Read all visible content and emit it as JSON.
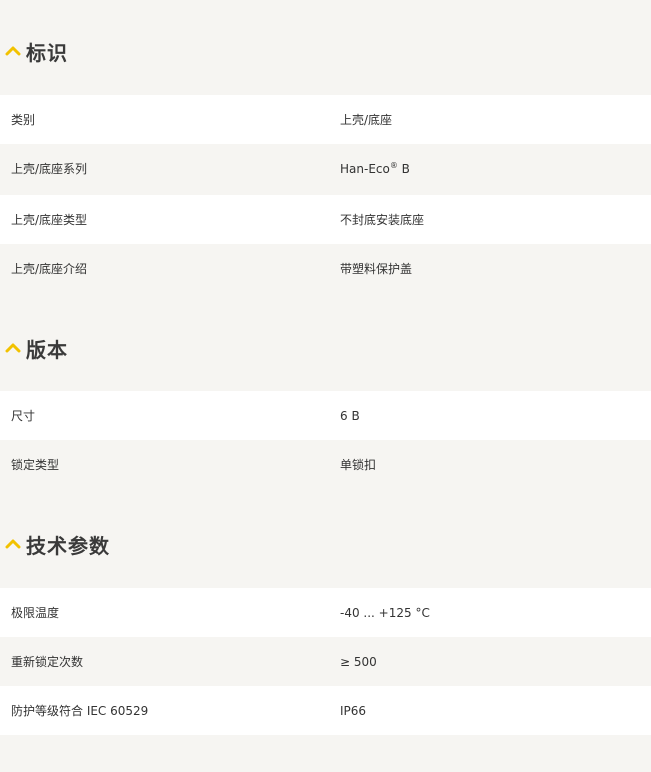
{
  "sections": [
    {
      "title": "标识",
      "rows": [
        {
          "label": "类别",
          "value": "上壳/底座"
        },
        {
          "label": "上壳/底座系列",
          "value": "Han-Eco",
          "sup": "®",
          "value_suffix": " B"
        },
        {
          "label": "上壳/底座类型",
          "value": "不封底安装底座"
        },
        {
          "label": "上壳/底座介绍",
          "value": "带塑料保护盖"
        }
      ]
    },
    {
      "title": "版本",
      "rows": [
        {
          "label": "尺寸",
          "value": "6 B"
        },
        {
          "label": "锁定类型",
          "value": "单锁扣"
        }
      ]
    },
    {
      "title": "技术参数",
      "rows": [
        {
          "label": "极限温度",
          "value": "-40 ... +125 °C"
        },
        {
          "label": "重新锁定次数",
          "value": "≥ 500"
        },
        {
          "label": "防护等级符合 IEC 60529",
          "value": "IP66"
        }
      ]
    }
  ],
  "colors": {
    "accent": "#f2c200",
    "row_white": "#ffffff",
    "row_grey": "#f6f5f2",
    "text": "#333333"
  },
  "icons": {
    "section_toggle": "chevron-up-icon"
  }
}
